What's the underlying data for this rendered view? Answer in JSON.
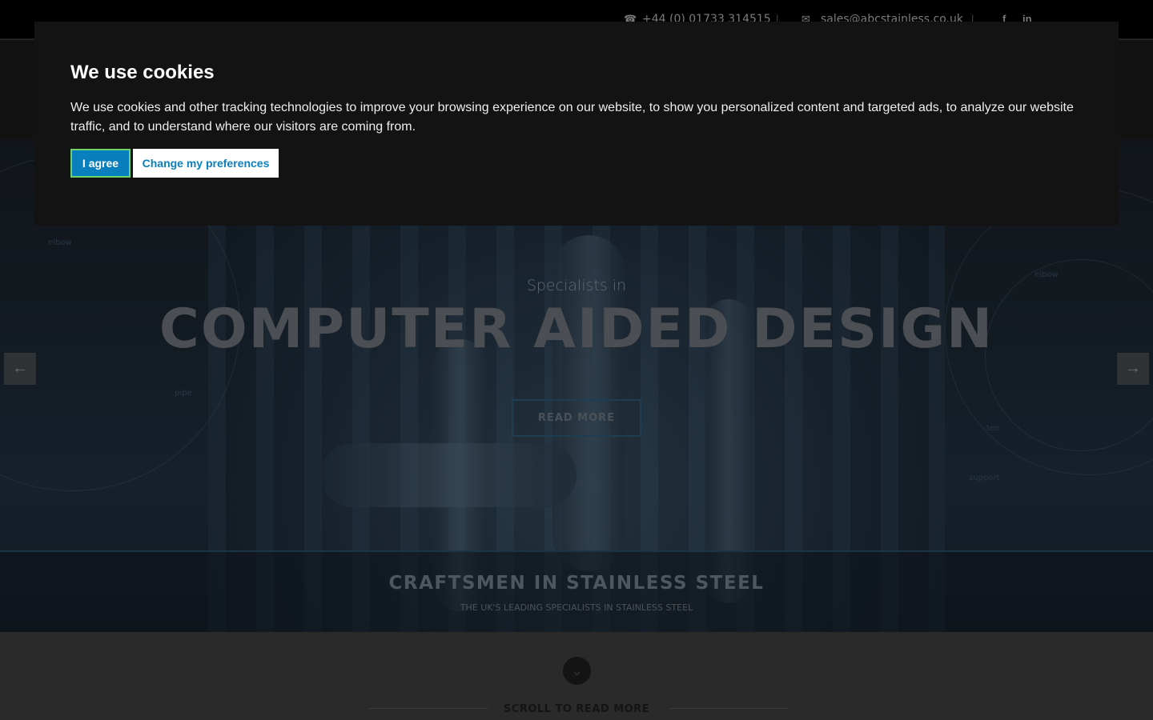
{
  "topbar": {
    "phone_icon": "phone-icon",
    "phone": "+44 (0) 01733 314515",
    "separator": "|",
    "email_icon": "envelope-icon",
    "email": "sales@abcstainless.co.uk",
    "social": [
      "facebook-icon",
      "linkedin-icon"
    ],
    "facebook_glyph": "f",
    "linkedin_glyph": "in"
  },
  "hero": {
    "subtitle": "Specialists in",
    "title": "COMPUTER AIDED DESIGN",
    "button": "READ MORE",
    "prev_arrow": "←",
    "next_arrow": "→",
    "blueprint_labels": [
      "elbow",
      "elbow",
      "tee",
      "pipe",
      "support"
    ]
  },
  "strip": {
    "title": "CRAFTSMEN IN STAINLESS STEEL",
    "subtitle": "THE UK'S LEADING SPECIALISTS IN STAINLESS STEEL"
  },
  "scroll": {
    "icon": "chevron-down-icon",
    "glyph": "⌄",
    "label": "SCROLL TO READ MORE"
  },
  "cookie": {
    "title": "We use cookies",
    "text": "We use cookies and other tracking technologies to improve your browsing experience on our website, to show you personalized content and targeted ads, to analyze our website traffic, and to understand where our visitors are coming from.",
    "agree": "I agree",
    "preferences": "Change my preferences"
  },
  "colors": {
    "accent": "#0a7fbd",
    "focus_ring": "#6fd26a",
    "banner_bg": "#131313"
  }
}
